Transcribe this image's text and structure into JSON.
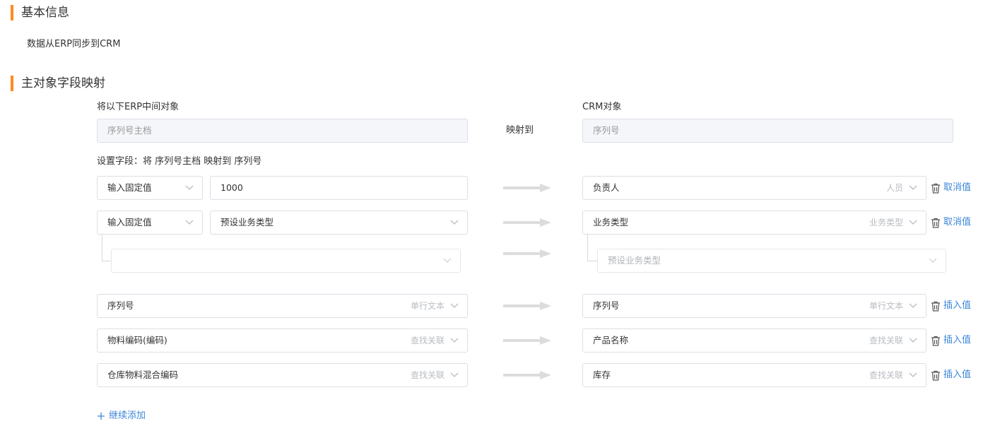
{
  "basic_info": {
    "title": "基本信息",
    "direction_text": "数据从ERP同步到CRM"
  },
  "mapping": {
    "title": "主对象字段映射",
    "erp_label": "将以下ERP中间对象",
    "erp_object": "序列号主档",
    "maps_to": "映射到",
    "crm_label": "CRM对象",
    "crm_object": "序列号",
    "set_fields_text": "设置字段：将 序列号主档 映射到 序列号",
    "rows": [
      {
        "source_type": "输入固定值",
        "source_value": "1000",
        "target_field": "负责人",
        "target_type": "人员",
        "action": "取消值"
      },
      {
        "source_type": "输入固定值",
        "source_value": "预设业务类型",
        "target_field": "业务类型",
        "target_type": "业务类型",
        "action": "取消值",
        "sub_source_placeholder": "",
        "sub_target_value": "预设业务类型"
      },
      {
        "source_field": "序列号",
        "source_type": "单行文本",
        "target_field": "序列号",
        "target_type": "单行文本",
        "action": "插入值"
      },
      {
        "source_field": "物料编码(编码)",
        "source_type": "查找关联",
        "target_field": "产品名称",
        "target_type": "查找关联",
        "action": "插入值"
      },
      {
        "source_field": "仓库物料混合编码",
        "source_type": "查找关联",
        "target_field": "库存",
        "target_type": "查找关联",
        "action": "插入值"
      }
    ],
    "add_more": "继续添加",
    "add_icon": "plus-icon"
  },
  "colors": {
    "accent_orange": "#ff8a1f",
    "link_blue": "#3d86d8",
    "arrow_gray": "#dcdcdc"
  },
  "icons": {
    "dropdown": "chevron-down-icon",
    "delete": "trash-icon",
    "mapping_arrow": "arrow-right-icon"
  }
}
